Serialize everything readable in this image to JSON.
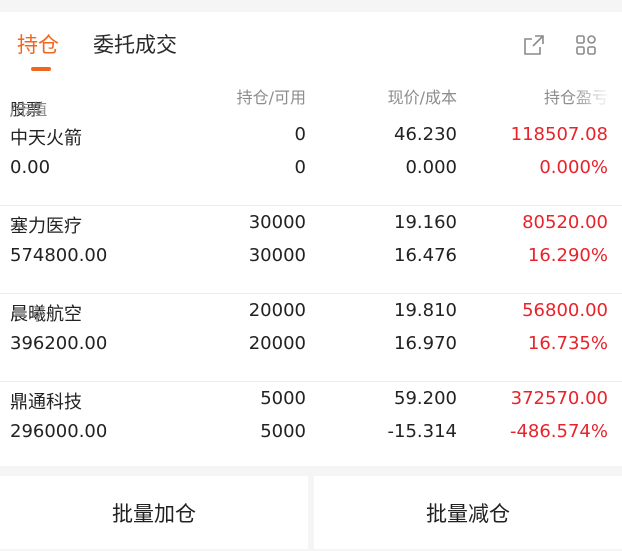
{
  "tabs": [
    {
      "label": "持仓",
      "active": true
    },
    {
      "label": "委托成交",
      "active": false
    }
  ],
  "icons": {
    "share": "share-external-icon",
    "grid": "grid-apps-icon"
  },
  "colors": {
    "accent": "#f0661e",
    "profit": "#e8232b",
    "text": "#222222",
    "muted": "#8d8d8d"
  },
  "columns": {
    "stock": "股票",
    "market_value": "/市值",
    "position": "持仓/可用",
    "price": "现价/成本",
    "profit": "持仓盈亏"
  },
  "holdings": [
    {
      "name": "中天火箭",
      "market_value": "0.00",
      "position": "0",
      "available": "0",
      "price": "46.230",
      "cost": "0.000",
      "profit": "118507.08",
      "profit_pct": "0.000%"
    },
    {
      "name": "塞力医疗",
      "market_value": "574800.00",
      "position": "30000",
      "available": "30000",
      "price": "19.160",
      "cost": "16.476",
      "profit": "80520.00",
      "profit_pct": "16.290%"
    },
    {
      "name": "晨曦航空",
      "market_value": "396200.00",
      "position": "20000",
      "available": "20000",
      "price": "19.810",
      "cost": "16.970",
      "profit": "56800.00",
      "profit_pct": "16.735%"
    },
    {
      "name": "鼎通科技",
      "market_value": "296000.00",
      "position": "5000",
      "available": "5000",
      "price": "59.200",
      "cost": "-15.314",
      "profit": "372570.00",
      "profit_pct": "-486.574%"
    }
  ],
  "actions": {
    "batch_add": "批量加仓",
    "batch_reduce": "批量减仓"
  }
}
